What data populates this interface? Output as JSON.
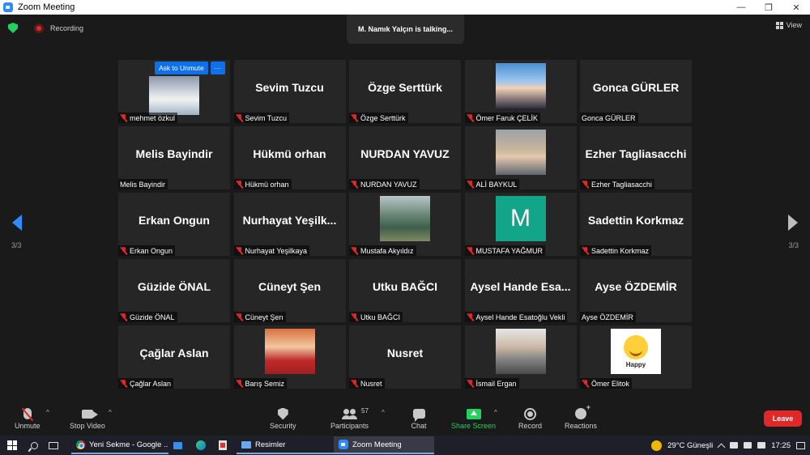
{
  "window": {
    "title": "Zoom Meeting",
    "controls": [
      "—",
      "❐",
      "✕"
    ]
  },
  "meeting": {
    "recording_label": "Recording",
    "talking_banner": "M. Namık Yalçın is talking...",
    "view_label": "View",
    "page_indicator_left": "3/3",
    "page_indicator_right": "3/3"
  },
  "ask_to_unmute": {
    "label": "Ask to Unmute",
    "more_label": "···"
  },
  "tiles": [
    {
      "big_name": "",
      "label": "mehmet özkul",
      "photo": "landscape",
      "ask_unmute": true
    },
    {
      "big_name": "Sevim Tuzcu",
      "label": "Sevim Tuzcu"
    },
    {
      "big_name": "Özge Serttürk",
      "label": "Özge Serttürk"
    },
    {
      "big_name": "",
      "label": "Ömer Faruk ÇELİK",
      "photo": "portrait1"
    },
    {
      "big_name": "Gonca GÜRLER",
      "label": "Gonca GÜRLER",
      "muted": false
    },
    {
      "big_name": "Melis Bayindir",
      "label": "Melis Bayindir",
      "muted": false
    },
    {
      "big_name": "Hükmü orhan",
      "label": "Hükmü orhan"
    },
    {
      "big_name": "NURDAN YAVUZ",
      "label": "NURDAN YAVUZ"
    },
    {
      "big_name": "",
      "label": "ALİ BAYKUL",
      "photo": "portrait2"
    },
    {
      "big_name": "Ezher Tagliasacchi",
      "label": "Ezher Tagliasacchi"
    },
    {
      "big_name": "Erkan Ongun",
      "label": "Erkan Ongun"
    },
    {
      "big_name": "Nurhayat Yeşilk...",
      "label": "Nurhayat Yeşilkaya"
    },
    {
      "big_name": "",
      "label": "Mustafa Akyıldız",
      "photo": "mountain"
    },
    {
      "big_name": "",
      "label": "MUSTAFA YAĞMUR",
      "photo": "m-avatar",
      "avatar_letter": "M"
    },
    {
      "big_name": "Sadettin Korkmaz",
      "label": "Sadettin Korkmaz"
    },
    {
      "big_name": "Güzide ÖNAL",
      "label": "Güzide ÖNAL"
    },
    {
      "big_name": "Cüneyt Şen",
      "label": "Cüneyt Şen"
    },
    {
      "big_name": "Utku BAĞCI",
      "label": "Utku BAĞCI"
    },
    {
      "big_name": "Aysel Hande Esa...",
      "label": "Aysel Hande Esatoğlu Vekli"
    },
    {
      "big_name": "Ayse ÖZDEMİR",
      "label": "Ayse ÖZDEMİR",
      "muted": false
    },
    {
      "big_name": "Çağlar Aslan",
      "label": "Çağlar Aslan"
    },
    {
      "big_name": "",
      "label": "Barış Semiz",
      "photo": "portrait3"
    },
    {
      "big_name": "Nusret",
      "label": "Nusret"
    },
    {
      "big_name": "",
      "label": "İsmail Ergan",
      "photo": "portrait4"
    },
    {
      "big_name": "",
      "label": "Ömer Elitok",
      "photo": "happy",
      "happy_text": "Happy"
    }
  ],
  "toolbar": {
    "unmute": "Unmute",
    "stop_video": "Stop Video",
    "security": "Security",
    "participants": "Participants",
    "participants_count": "57",
    "chat": "Chat",
    "share_screen": "Share Screen",
    "record": "Record",
    "reactions": "Reactions",
    "leave": "Leave",
    "caret": "^"
  },
  "taskbar": {
    "apps": [
      {
        "label": "Yeni Sekme - Google ...",
        "icon": "chrome-icon",
        "state": "open"
      },
      {
        "label": "",
        "icon": "photos-icon"
      },
      {
        "label": "",
        "icon": "edge-icon"
      },
      {
        "label": "",
        "icon": "pdf-icon"
      },
      {
        "label": "Resimler",
        "icon": "folder-icon",
        "state": "open"
      },
      {
        "label": "Zoom Meeting",
        "icon": "zoom-icon",
        "state": "active"
      }
    ],
    "weather": "29°C  Güneşli",
    "time": "17:25"
  },
  "colors": {
    "accent_blue": "#0e71eb",
    "share_green": "#23d160",
    "leave_red": "#e02828",
    "background": "#1a1a1a",
    "tile": "#262626"
  }
}
